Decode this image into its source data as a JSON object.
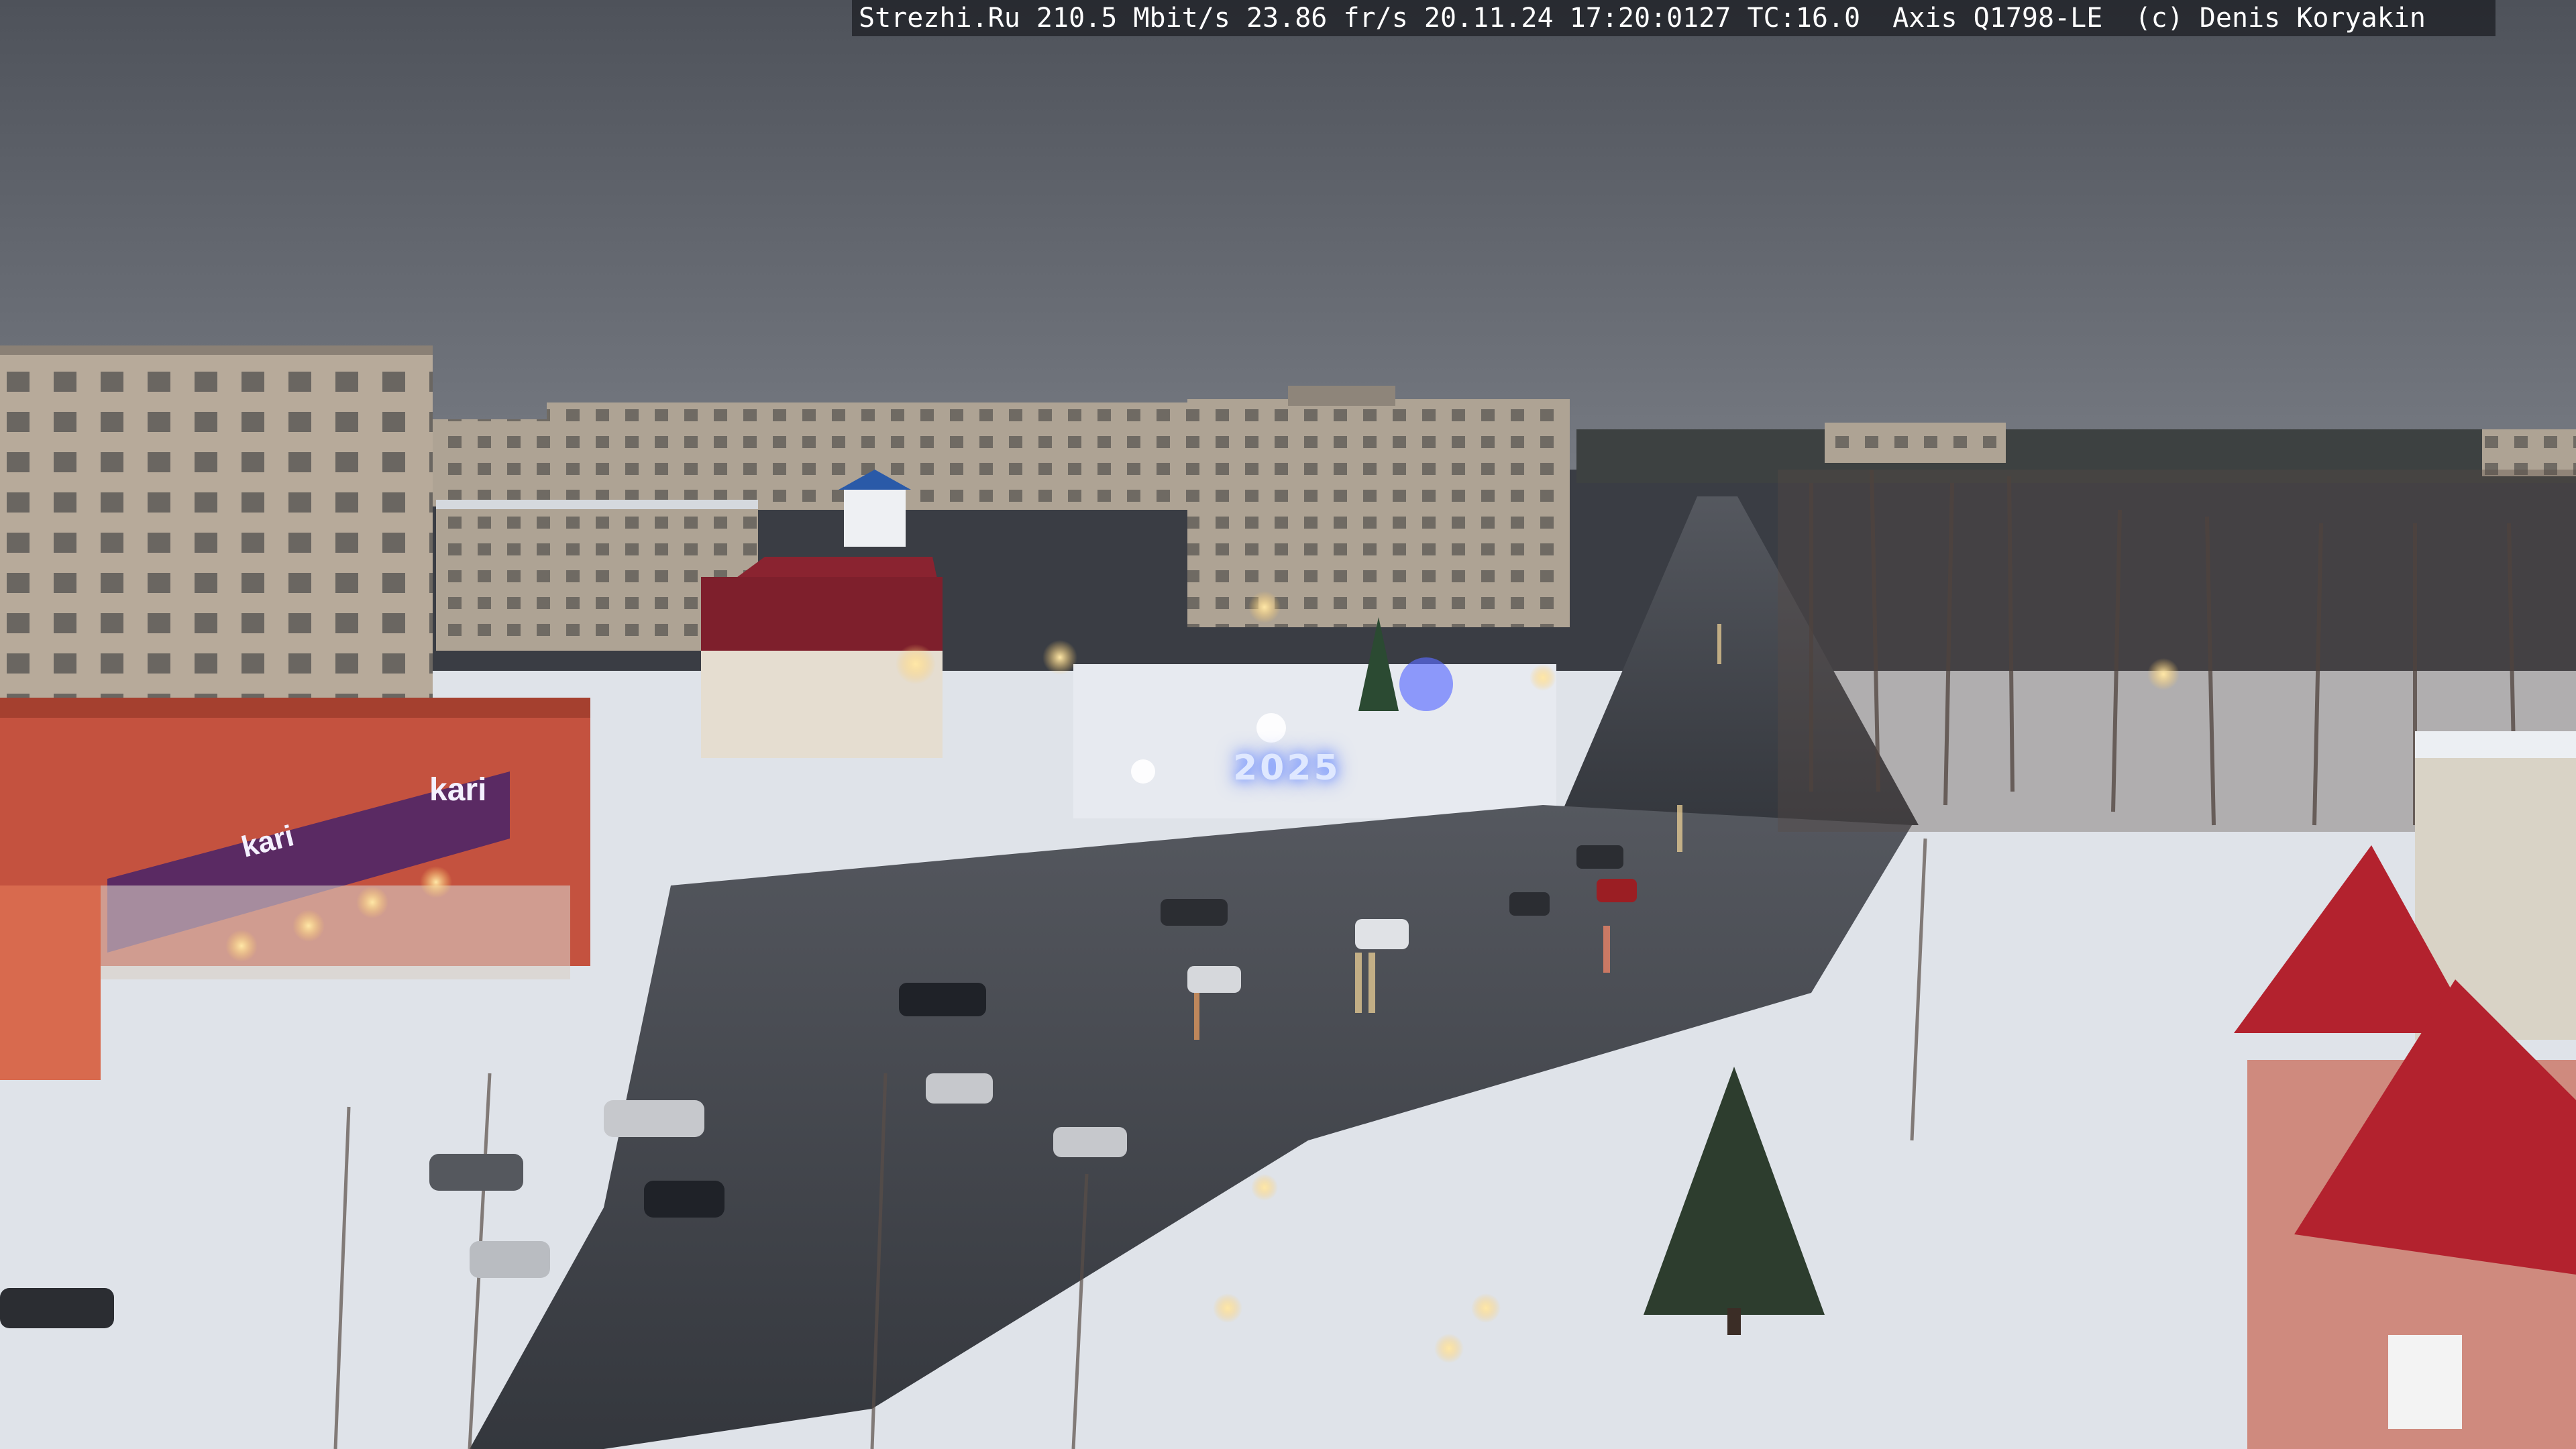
{
  "overlay": {
    "text": "Strezhi.Ru 210.5 Mbit/s 23.86 fr/s 20.11.24 17:20:0127 TC:16.0  Axis Q1798-LE  (c) Denis Koryakin"
  },
  "signs": {
    "store_name": "kari",
    "store_name_2": "kari",
    "year_display": "2025"
  },
  "colors": {
    "sky": "#5c6069",
    "snow": "#e6e9ee",
    "road": "#3e4148",
    "building_panel": "#b8ab9c",
    "store_red": "#c4523f",
    "store_purple": "#5a2a63",
    "roof_red": "#b3222e"
  }
}
